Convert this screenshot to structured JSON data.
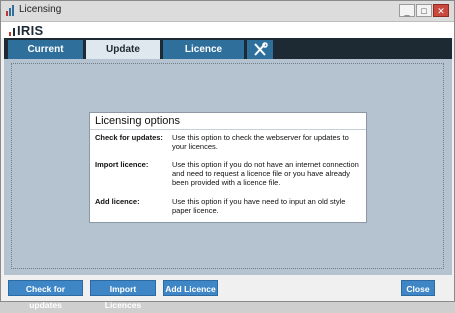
{
  "window": {
    "title": "Licensing",
    "minimize_glyph": "_",
    "maximize_glyph": "□",
    "close_glyph": "✕"
  },
  "brand": {
    "name": "IRIS"
  },
  "tabs": [
    {
      "label": "Current Licences"
    },
    {
      "label": "Update Licences",
      "active": true
    },
    {
      "label": "Licence Agreement"
    }
  ],
  "tools_tab_icon": "tools-icon",
  "options_panel": {
    "title": "Licensing options",
    "rows": [
      {
        "label": "Check for updates:",
        "desc": "Use this option to check the webserver for updates to your licences."
      },
      {
        "label": "Import licence:",
        "desc": "Use this option if you do not have an internet connection and need to request a licence file or you have already been provided with a licence file."
      },
      {
        "label": "Add licence:",
        "desc": "Use this option if you have need to input an old style paper licence."
      }
    ]
  },
  "footer": {
    "check_label": "Check for updates",
    "import_label": "Import Licences",
    "add_label": "Add Licence",
    "close_label": "Close"
  },
  "colors": {
    "accent": "#3f86c6",
    "tabbar": "#1e2a33",
    "tab": "#2f6f9c",
    "content_bg": "#b5c2cf"
  }
}
